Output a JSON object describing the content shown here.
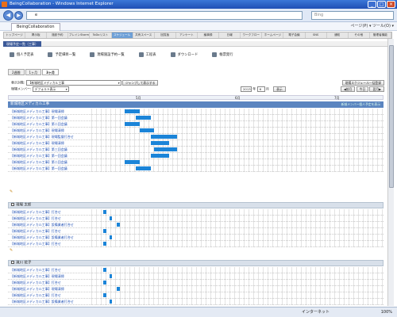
{
  "window": {
    "title": "BeingCollaboration - Windows Internet Explorer"
  },
  "browser": {
    "address": "e",
    "search_placeholder": "Bing",
    "tab": "BeingCollaboration",
    "tools": "ページ(P) ▾  ツール(O) ▾"
  },
  "appnav": [
    "トップページ",
    "掲示板",
    "施設予約",
    "ブレインStorm",
    "ToDoリスト",
    "スケジュール",
    "共有スペース",
    "回覧板",
    "アンケート",
    "議事録",
    "日報",
    "ワークフロー",
    "ホームページ",
    "電子会議",
    "SNS",
    "通知",
    "その他",
    "管理者機能"
  ],
  "appnav_active": 5,
  "page": {
    "title": "現場予定一覧（工事）"
  },
  "icons": [
    {
      "label": "個人予定表"
    },
    {
      "label": "予定細目一覧"
    },
    {
      "label": "現場施設予約一覧"
    },
    {
      "label": "工程表"
    },
    {
      "label": "ダウンロード"
    },
    {
      "label": "帳票発行"
    }
  ],
  "period_tabs": [
    "2週間",
    "1ヶ月",
    "3ヶ月"
  ],
  "period_active": 2,
  "filters": {
    "show_label": "表示対象:",
    "show_value": "【新城地区メディカル工事",
    "member_label": "現場メンバー:",
    "member_value": "デフォルト表示",
    "jump_button": "ジャンプして表示する",
    "schedule_button": "現場スケジュール一括登録",
    "year_value": "2013",
    "year_unit": "年",
    "month_value": "6",
    "month_unit": "月",
    "apply_button": "表示",
    "prev_button": "◀前月",
    "today_button": "今日",
    "next_button": "翌月▶"
  },
  "months": [
    "5月",
    "6月",
    "7月"
  ],
  "group1": {
    "title": "新城地区メディカル工事",
    "link": "新城メンバー個人予定を表示",
    "rows": [
      {
        "label": "【新城地区メディカル工事】現場清掃",
        "bar": [
          0.31,
          0.35
        ]
      },
      {
        "label": "【新城地区メディカル工事】第一回会議",
        "bar": [
          0.34,
          0.38
        ]
      },
      {
        "label": "【新城地区メディカル工事】第二回会議",
        "bar": [
          0.31,
          0.35
        ]
      },
      {
        "label": "【新城地区メディカル工事】現場清掃",
        "bar": [
          0.35,
          0.39
        ]
      },
      {
        "label": "【新城地区メディカル工事】現場監督打合せ",
        "bar": [
          0.38,
          0.45
        ]
      },
      {
        "label": "【新城地区メディカル工事】現場清掃",
        "bar": [
          0.38,
          0.43
        ]
      },
      {
        "label": "【新城地区メディカル工事】第三回会議",
        "bar": [
          0.39,
          0.45
        ]
      },
      {
        "label": "【新城地区メディカル工事】第一回会議",
        "bar": [
          0.38,
          0.43
        ]
      },
      {
        "label": "【新城地区メディカル工事】第二回会議",
        "bar": [
          0.31,
          0.35
        ]
      },
      {
        "label": "【新城地区メディカル工事】第一回会議",
        "bar": [
          0.34,
          0.38
        ]
      }
    ]
  },
  "group2": {
    "user": "現場 太郎",
    "rows": [
      {
        "label": "【新城地区メディカル工事】打合せ",
        "bar": [
          0.254,
          0.262
        ]
      },
      {
        "label": "【新城地区メディカル工事】打合せ",
        "bar": [
          0.27,
          0.278
        ]
      },
      {
        "label": "【新城地区メディカル工事】設備業者打合せ",
        "bar": [
          0.29,
          0.298
        ]
      },
      {
        "label": "【新城地区メディカル工事】打合せ",
        "bar": [
          0.254,
          0.262
        ]
      },
      {
        "label": "【新城地区メディカル工事】設備業者打合せ",
        "bar": [
          0.27,
          0.278
        ]
      },
      {
        "label": "【新城地区メディカル工事】打合せ",
        "bar": [
          0.254,
          0.262
        ]
      }
    ]
  },
  "group3": {
    "user": "滝川 花子",
    "rows": [
      {
        "label": "【新城地区メディカル工事】打合せ",
        "bar": [
          0.254,
          0.262
        ]
      },
      {
        "label": "【新城地区メディカル工事】現場清掃",
        "bar": [
          0.27,
          0.278
        ]
      },
      {
        "label": "【新城地区メディカル工事】打合せ",
        "bar": [
          0.254,
          0.262
        ]
      },
      {
        "label": "【新城地区メディカル工事】現場清掃",
        "bar": [
          0.29,
          0.298
        ]
      },
      {
        "label": "【新城地区メディカル工事】打合せ",
        "bar": [
          0.254,
          0.262
        ]
      },
      {
        "label": "【新城地区メディカル工事】設備業者打合せ",
        "bar": [
          0.27,
          0.278
        ]
      }
    ]
  },
  "status": {
    "internet": "インターネット",
    "zoom": "100%"
  }
}
